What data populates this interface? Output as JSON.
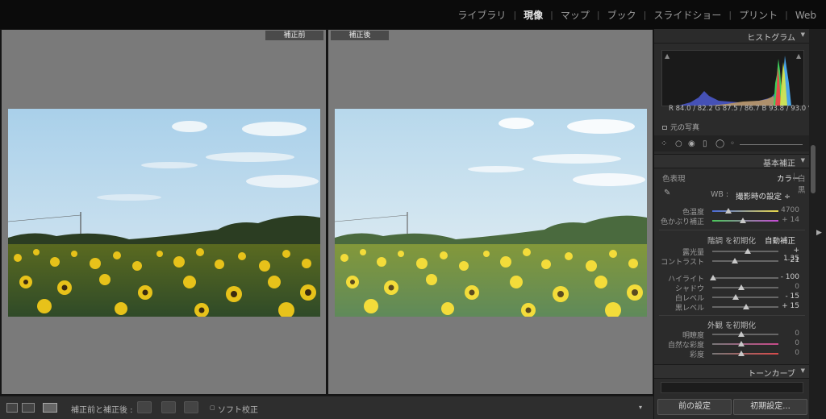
{
  "modules": [
    {
      "label": "ライブラリ",
      "active": false
    },
    {
      "label": "現像",
      "active": true
    },
    {
      "label": "マップ",
      "active": false
    },
    {
      "label": "ブック",
      "active": false
    },
    {
      "label": "スライドショー",
      "active": false
    },
    {
      "label": "プリント",
      "active": false
    },
    {
      "label": "Web",
      "active": false
    }
  ],
  "viewer": {
    "before_label": "補正前",
    "after_label": "補正後"
  },
  "toolbar": {
    "compare_label": "補正前と補正後 :",
    "soft_proof_label": "ソフト校正"
  },
  "histogram": {
    "title": "ヒストグラム",
    "rgb_readout": "R 84.0 / 82.2   G 87.5 / 86.7   B 93.8 / 93.0 %",
    "original_photo_label": "元の写真"
  },
  "basic": {
    "title": "基本補正",
    "treatment_label": "色表現",
    "color_label": "カラー",
    "bw_label": "白黒",
    "wb_label": "WB :",
    "wb_value": "撮影時の設定 ÷",
    "temp_label": "色温度",
    "temp_value": "4700",
    "tint_label": "色かぶり補正",
    "tint_value": "+ 14",
    "tone_label": "階調 を初期化",
    "auto_label": "自動補正",
    "exposure_label": "露光量",
    "exposure_value": "+ 1.35",
    "contrast_label": "コントラスト",
    "contrast_value": "- 21",
    "highlights_label": "ハイライト",
    "highlights_value": "- 100",
    "shadows_label": "シャドウ",
    "shadows_value": "0",
    "whites_label": "白レベル",
    "whites_value": "- 15",
    "blacks_label": "黒レベル",
    "blacks_value": "+ 15",
    "presence_label": "外観 を初期化",
    "clarity_label": "明瞭度",
    "clarity_value": "0",
    "vibrance_label": "自然な彩度",
    "vibrance_value": "0",
    "saturation_label": "彩度",
    "saturation_value": "0"
  },
  "tonecurve": {
    "title": "トーンカーブ"
  },
  "buttons": {
    "previous": "前の設定",
    "reset": "初期設定..."
  },
  "colors": {
    "accent_active": "#e8e8e8",
    "panel_bg": "#2b2b2b"
  }
}
